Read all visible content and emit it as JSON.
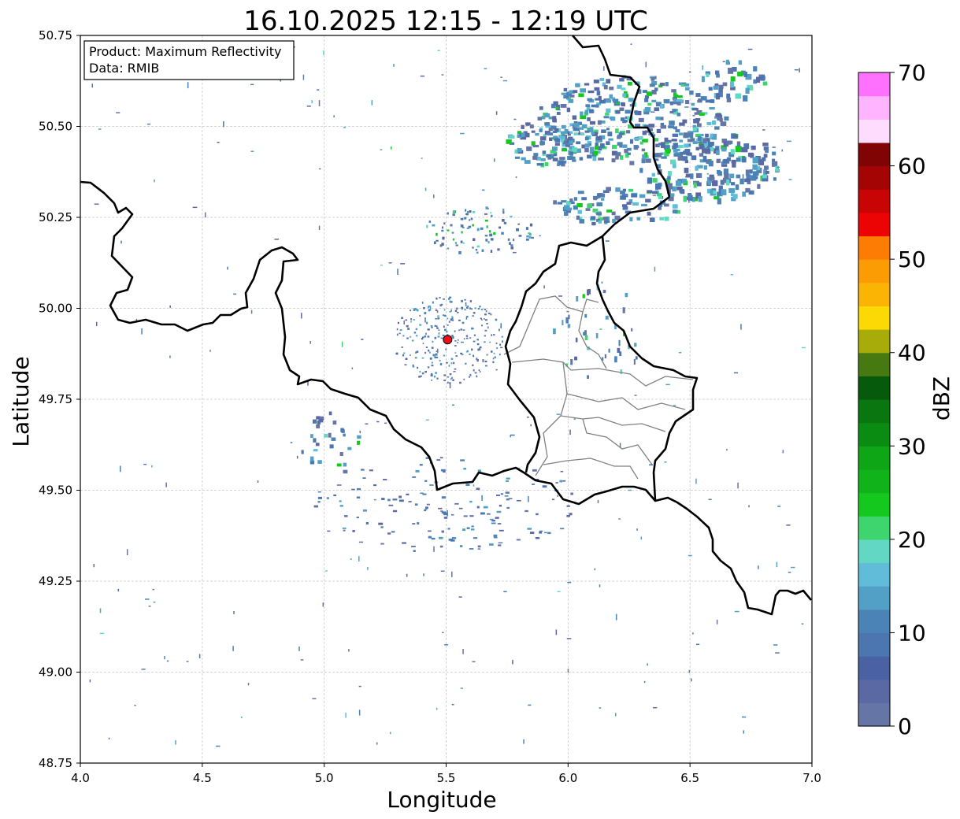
{
  "figure": {
    "title": "16.10.2025 12:15 - 12:19 UTC",
    "info_box": {
      "line1": "Product: Maximum Reflectivity",
      "line2": "Data: RMIB"
    }
  },
  "map": {
    "type": "radar-reflectivity-map",
    "xlabel": "Longitude",
    "ylabel": "Latitude",
    "xlim": [
      4.0,
      7.0
    ],
    "ylim": [
      48.75,
      50.75
    ],
    "x_ticks": [
      "4.0",
      "4.5",
      "5.0",
      "5.5",
      "6.0",
      "6.5",
      "7.0"
    ],
    "y_ticks": [
      "48.75",
      "49.00",
      "49.25",
      "49.50",
      "49.75",
      "50.00",
      "50.25",
      "50.50",
      "50.75"
    ],
    "grid": true,
    "radar_site": {
      "lon": 5.506,
      "lat": 49.914
    },
    "colors": {
      "border": "#000000",
      "admin_border": "#808080",
      "grid": "#c8c8c8",
      "site_marker": "#e8101a"
    }
  },
  "colorbar": {
    "label": "dBZ",
    "ticks": [
      "0",
      "10",
      "20",
      "30",
      "40",
      "50",
      "60",
      "70"
    ],
    "range": [
      0,
      70
    ],
    "step": 2.5,
    "colors": [
      "#6475a6",
      "#5a68a3",
      "#4a62a3",
      "#4b76b0",
      "#4b83b6",
      "#53a0c6",
      "#60bcd8",
      "#62d8c4",
      "#3ed46e",
      "#14c81e",
      "#10b41a",
      "#0ea516",
      "#0a8c12",
      "#09760f",
      "#065a0c",
      "#467a10",
      "#a8ac08",
      "#fcd804",
      "#fcb404",
      "#fc9c04",
      "#fc7c04",
      "#ec0404",
      "#c80404",
      "#a40404",
      "#800404",
      "#fedcfe",
      "#feb4fe",
      "#fe70fe",
      "#ee3cee"
    ]
  }
}
